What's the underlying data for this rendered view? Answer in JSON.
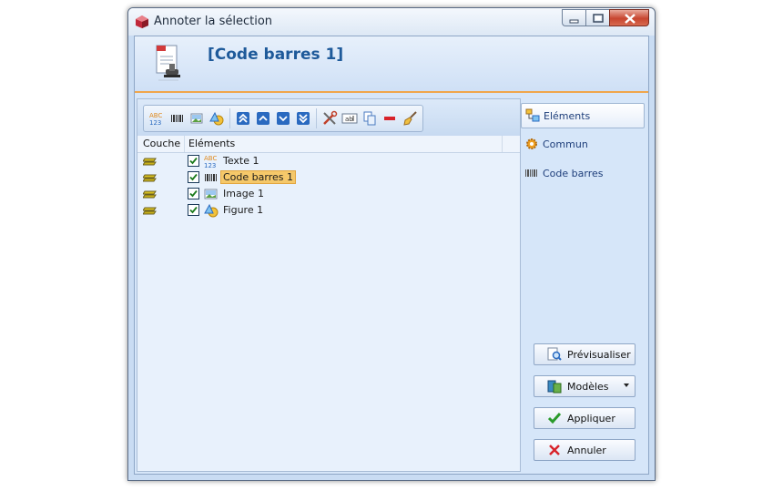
{
  "window": {
    "title": "Annoter la sélection"
  },
  "header": {
    "title": "[Code barres 1]"
  },
  "list": {
    "col_layer": "Couche",
    "col_elements": "Eléments",
    "rows": [
      {
        "label": "Texte 1",
        "checked": true,
        "icon": "text-abc-icon",
        "selected": false
      },
      {
        "label": "Code barres 1",
        "checked": true,
        "icon": "barcode-icon",
        "selected": true
      },
      {
        "label": "Image 1",
        "checked": true,
        "icon": "image-icon",
        "selected": false
      },
      {
        "label": "Figure 1",
        "checked": true,
        "icon": "shape-icon",
        "selected": false
      }
    ]
  },
  "nav": {
    "elements": "Eléments",
    "commun": "Commun",
    "code_barres": "Code barres"
  },
  "actions": {
    "preview": "Prévisualiser",
    "models": "Modèles",
    "apply": "Appliquer",
    "cancel": "Annuler"
  },
  "colors": {
    "accent": "#1e5a9a",
    "selection": "#f5c86a",
    "panel": "#d6e6f9"
  }
}
